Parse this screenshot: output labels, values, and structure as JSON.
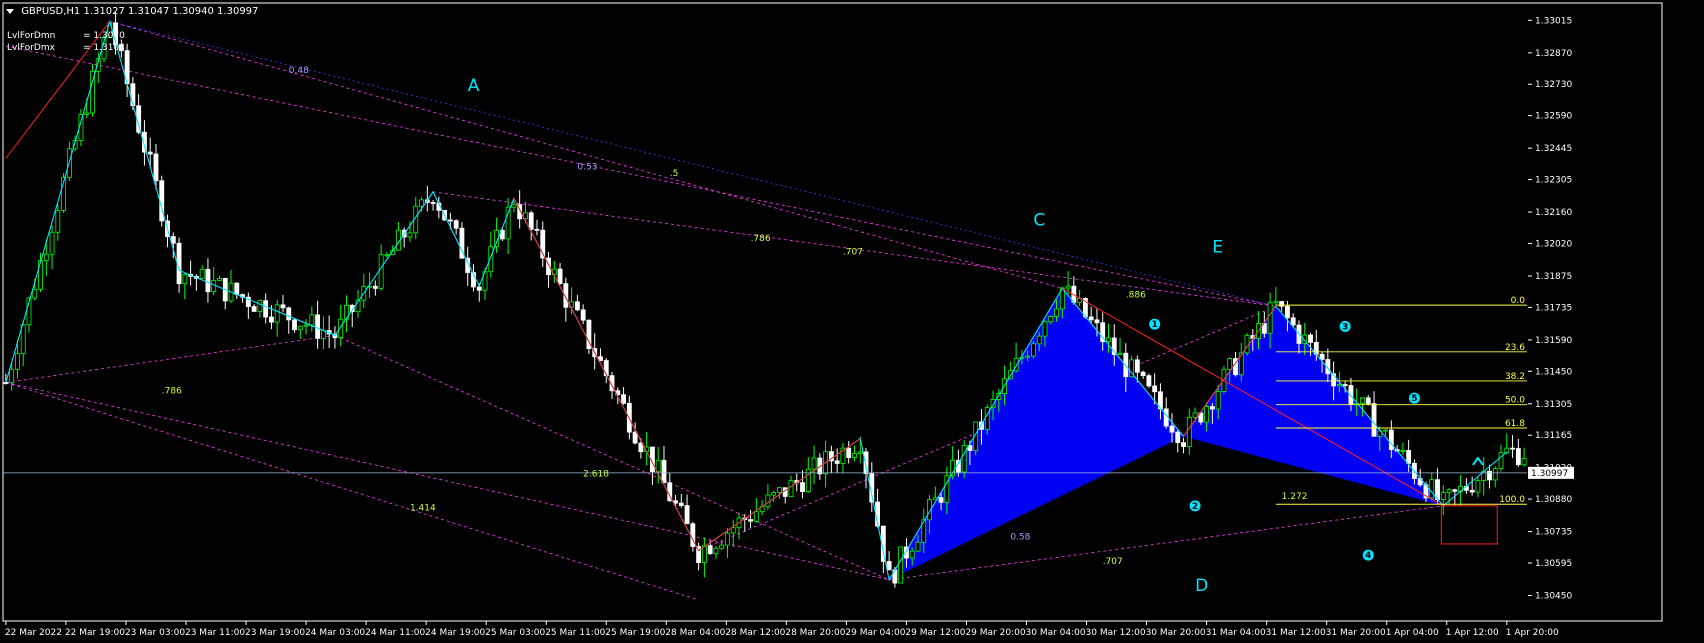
{
  "header": {
    "symbol": "GBPUSD,H1",
    "ohlc": "1.31027 1.31047 1.30940 1.30997"
  },
  "indicators": [
    {
      "label": "LvlForDmn",
      "value": "= 1.3070"
    },
    {
      "label": "LvlForDmx",
      "value": "= 1.3104"
    }
  ],
  "colors": {
    "background": "#000000",
    "candle_up": "#00ff00",
    "candle_down": "#ffffff",
    "pattern_fill": "#0000ff",
    "zigzag": "#00e5ff",
    "trend_red": "#ff2020",
    "dotted_magenta": "#ff3cff",
    "dotted_blue": "#4040ff",
    "fib_yellow": "#ffff40",
    "ratio_text": "#c8ff40",
    "label_cyan": "#00e5ff"
  },
  "chart_data": {
    "type": "candlestick",
    "title": "GBPUSD,H1",
    "current_price": "1.30997",
    "ylim": [
      1.3043,
      1.3307
    ],
    "y_ticks": [
      "1.33015",
      "1.32870",
      "1.32730",
      "1.32590",
      "1.32445",
      "1.32305",
      "1.32160",
      "1.32020",
      "1.31875",
      "1.31735",
      "1.31590",
      "1.31450",
      "1.31305",
      "1.31165",
      "1.31020",
      "1.30880",
      "1.30735",
      "1.30595",
      "1.30450"
    ],
    "x_ticks": [
      "22 Mar 2022",
      "22 Mar 19:00",
      "23 Mar 03:00",
      "23 Mar 11:00",
      "23 Mar 19:00",
      "24 Mar 03:00",
      "24 Mar 11:00",
      "24 Mar 19:00",
      "25 Mar 03:00",
      "25 Mar 11:00",
      "25 Mar 19:00",
      "28 Mar 04:00",
      "28 Mar 12:00",
      "28 Mar 20:00",
      "29 Mar 04:00",
      "29 Mar 12:00",
      "29 Mar 20:00",
      "30 Mar 04:00",
      "30 Mar 12:00",
      "30 Mar 20:00",
      "31 Mar 04:00",
      "31 Mar 12:00",
      "31 Mar 20:00",
      "1 Apr 04:00",
      "1 Apr 12:00",
      "1 Apr 20:00"
    ],
    "swing_points": [
      {
        "bar": 0,
        "price": 1.314
      },
      {
        "bar": 18,
        "price": 1.3301
      },
      {
        "bar": 30,
        "price": 1.319
      },
      {
        "bar": 57,
        "price": 1.3161
      },
      {
        "bar": 74,
        "price": 1.3225
      },
      {
        "bar": 82,
        "price": 1.3183
      },
      {
        "bar": 88,
        "price": 1.3222
      },
      {
        "bar": 120,
        "price": 1.3065
      },
      {
        "bar": 148,
        "price": 1.3115
      },
      {
        "bar": 153,
        "price": 1.3052
      },
      {
        "bar": 183,
        "price": 1.3182
      },
      {
        "bar": 204,
        "price": 1.3116
      },
      {
        "bar": 220,
        "price": 1.3174
      },
      {
        "bar": 249,
        "price": 1.3085
      },
      {
        "bar": 260,
        "price": 1.3109
      }
    ],
    "pattern_labels": [
      "A",
      "C",
      "E",
      "D"
    ],
    "waves": [
      "1",
      "2",
      "3",
      "4",
      "5"
    ],
    "ratios": [
      {
        "text": "0.48"
      },
      {
        "text": "0.53"
      },
      {
        "text": ".5"
      },
      {
        "text": ".786"
      },
      {
        "text": ".707"
      },
      {
        "text": ".886"
      },
      {
        "text": ".786"
      },
      {
        "text": "2.618"
      },
      {
        "text": "1.414"
      },
      {
        "text": "0.58"
      },
      {
        "text": ".707"
      },
      {
        "text": "1.272"
      }
    ],
    "fib_levels": [
      {
        "text": "0.0",
        "price": 1.31745
      },
      {
        "text": "23.6",
        "price": 1.31537
      },
      {
        "text": "38.2",
        "price": 1.31407
      },
      {
        "text": "50.0",
        "price": 1.31301
      },
      {
        "text": "61.8",
        "price": 1.31197
      },
      {
        "text": "100.0",
        "price": 1.30857
      }
    ]
  }
}
